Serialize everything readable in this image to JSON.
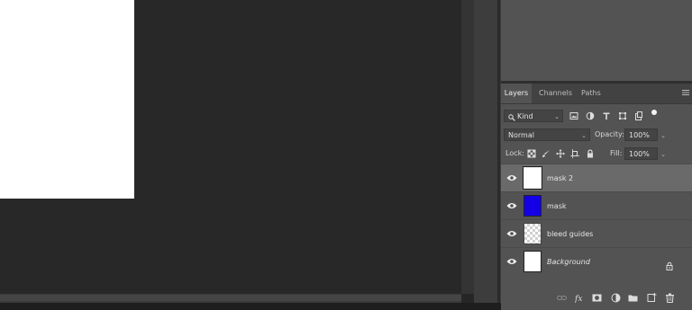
{
  "layers_panel": {
    "tabs": [
      {
        "label": "Layers",
        "active": true
      },
      {
        "label": "Channels",
        "active": false
      },
      {
        "label": "Paths",
        "active": false
      }
    ],
    "filter": {
      "value": "Kind"
    },
    "blend_mode": {
      "value": "Normal"
    },
    "opacity": {
      "label": "Opacity:",
      "value": "100%"
    },
    "lock": {
      "label": "Lock:"
    },
    "fill": {
      "label": "Fill:",
      "value": "100%"
    },
    "layers": [
      {
        "name": "mask 2",
        "visible": true,
        "selected": true,
        "thumb": "white",
        "italic": false,
        "locked": false
      },
      {
        "name": "mask",
        "visible": true,
        "selected": false,
        "thumb": "#1400e6",
        "italic": false,
        "locked": false
      },
      {
        "name": "bleed guides",
        "visible": true,
        "selected": false,
        "thumb": "transparent",
        "italic": false,
        "locked": false
      },
      {
        "name": "Background",
        "visible": true,
        "selected": false,
        "thumb": "white",
        "italic": true,
        "locked": true
      }
    ],
    "footer_icons": [
      "link-layers-icon",
      "fx-icon",
      "add-mask-icon",
      "adjustment-layer-icon",
      "new-group-icon",
      "new-layer-icon",
      "delete-layer-icon"
    ]
  },
  "colors": {
    "panel_bg": "#535353",
    "selected_layer": "#6a6a6a",
    "canvas_bg": "#282828",
    "mask_blue": "#1400e6"
  }
}
